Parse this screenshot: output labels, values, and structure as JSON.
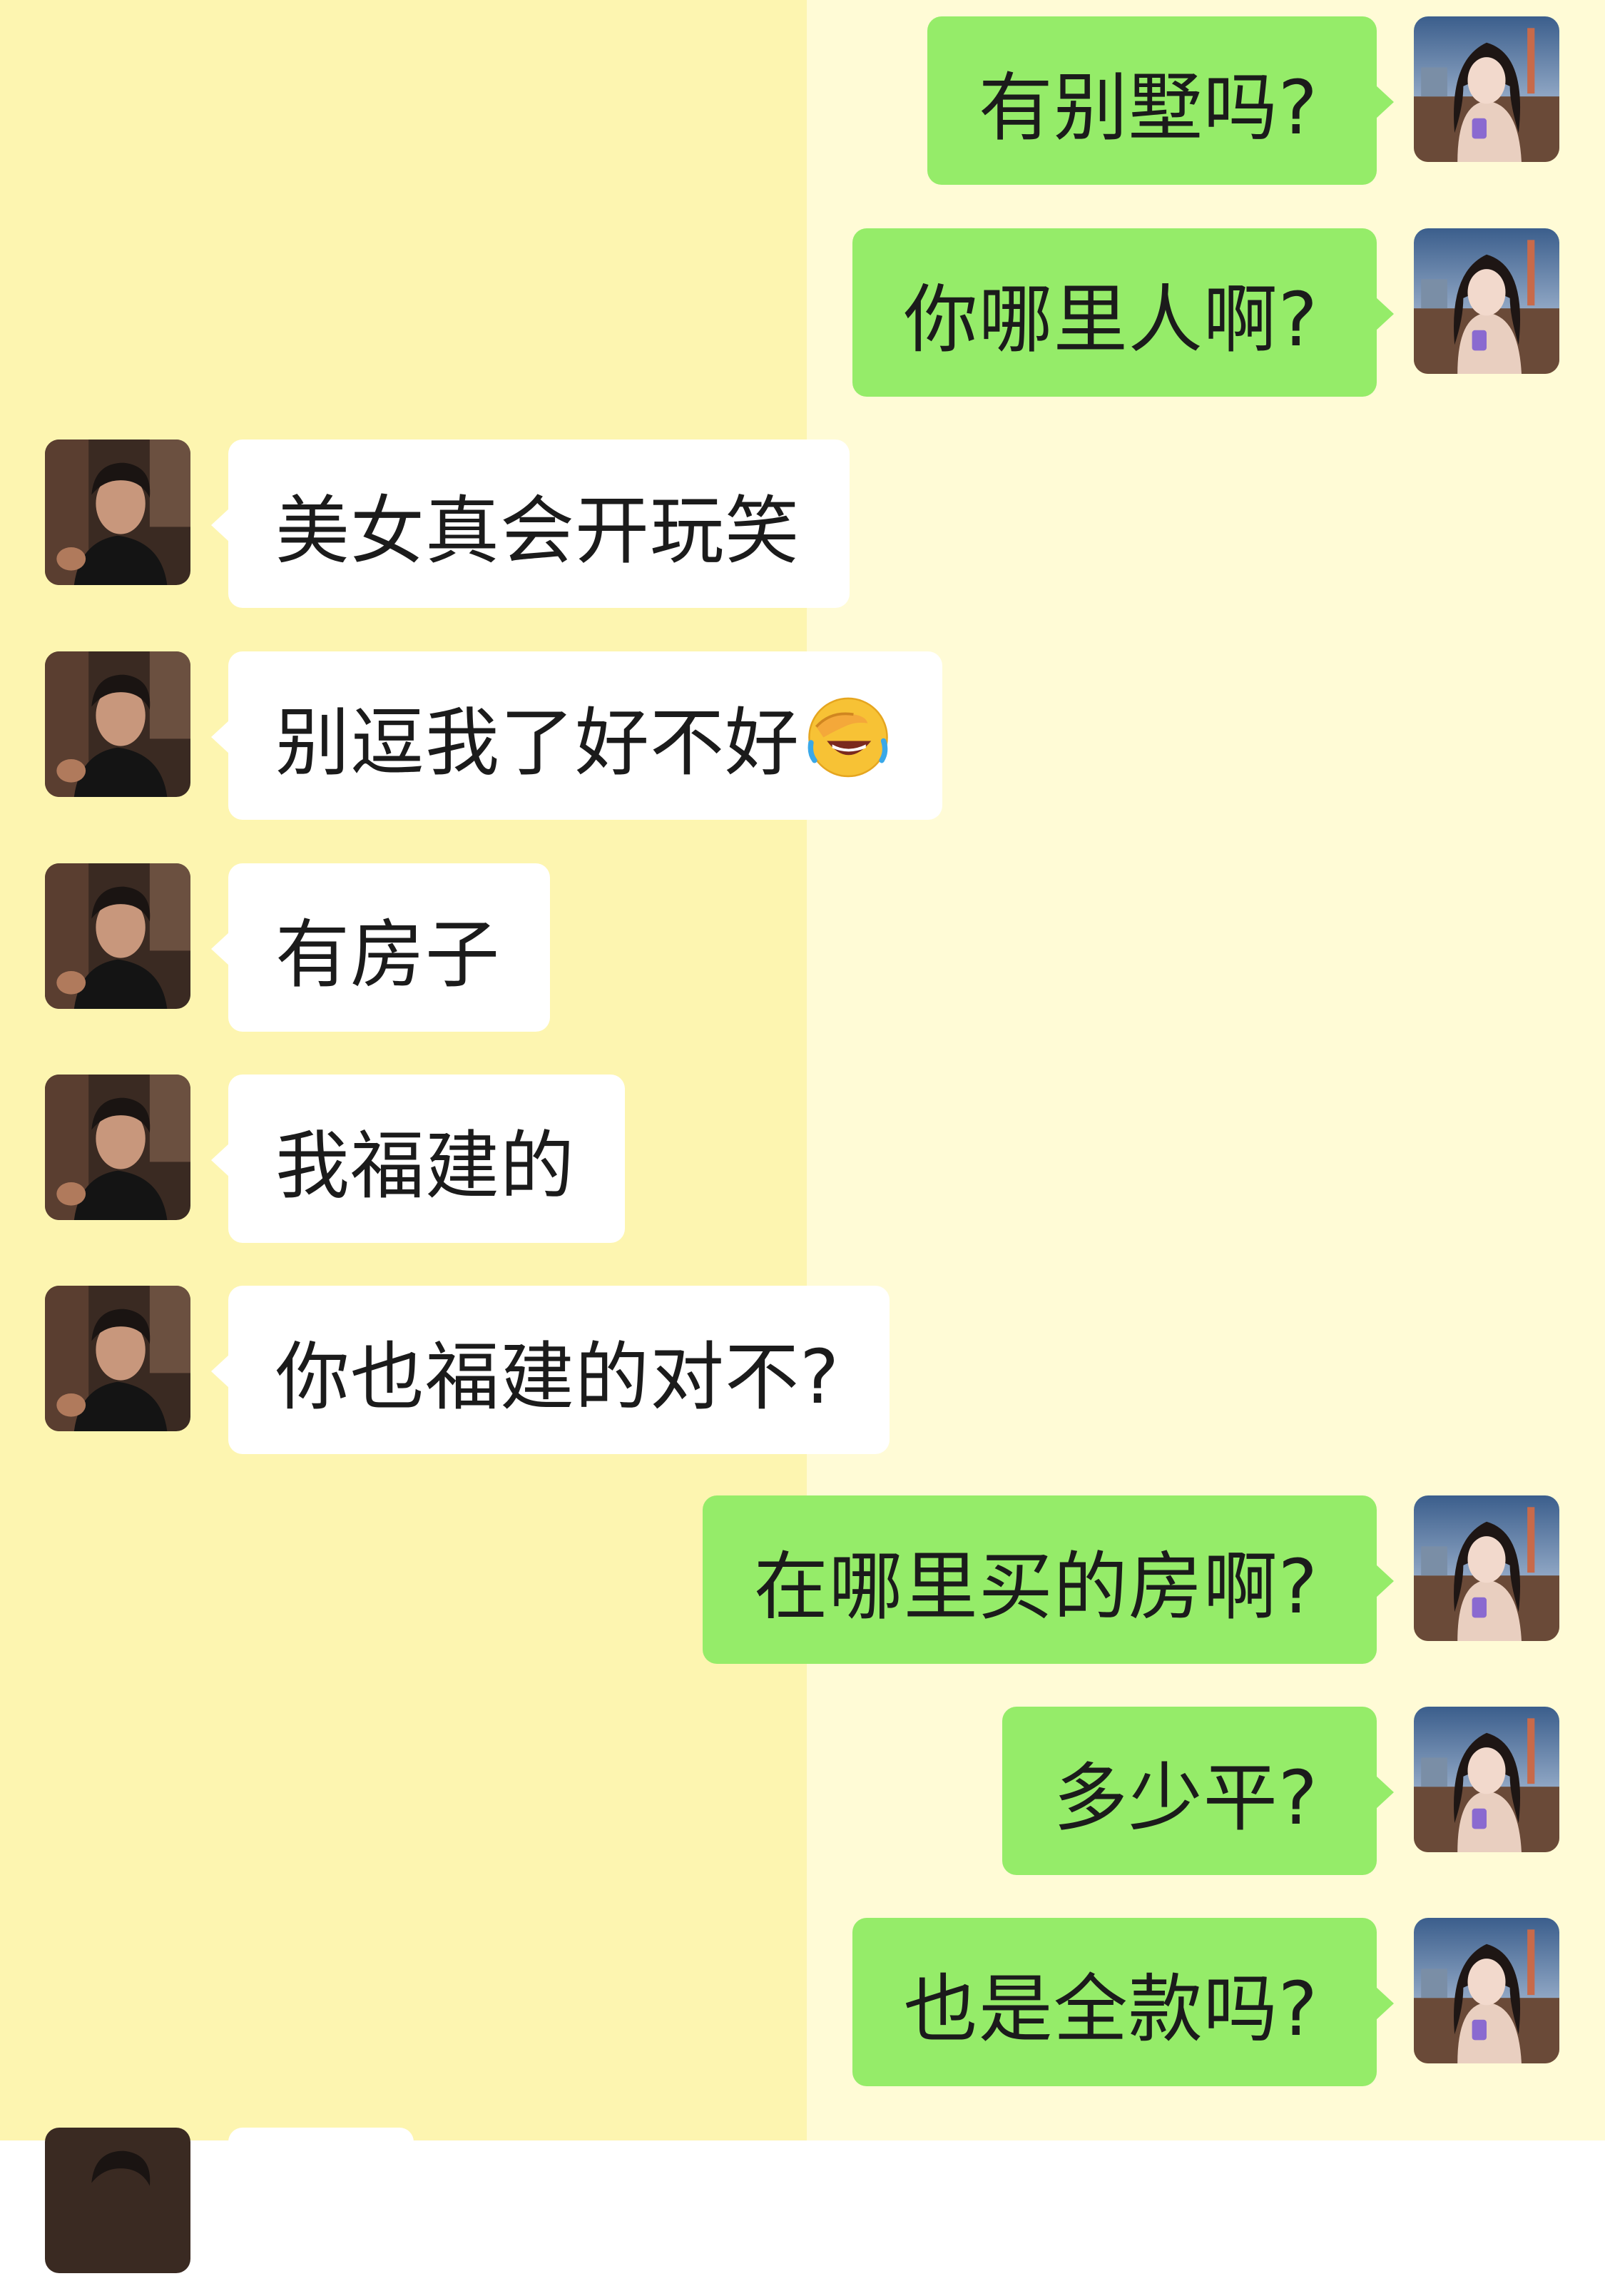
{
  "colors": {
    "left_background": "#fdf5b0",
    "right_background": "#fffbd6",
    "outgoing_bubble": "#95ec69",
    "incoming_bubble": "#ffffff"
  },
  "avatars": {
    "outgoing": "woman-avatar",
    "incoming": "man-avatar"
  },
  "messages": [
    {
      "side": "out",
      "text": "有别墅吗?"
    },
    {
      "side": "out",
      "text": "你哪里人啊?"
    },
    {
      "side": "in",
      "text": "美女真会开玩笑"
    },
    {
      "side": "in",
      "text": "别逗我了好不好",
      "emoji": "facepalm-laughing-emoji"
    },
    {
      "side": "in",
      "text": "有房子"
    },
    {
      "side": "in",
      "text": "我福建的"
    },
    {
      "side": "in",
      "text": "你也福建的对不?"
    },
    {
      "side": "out",
      "text": "在哪里买的房啊?"
    },
    {
      "side": "out",
      "text": "多少平?"
    },
    {
      "side": "out",
      "text": "也是全款吗?"
    }
  ]
}
